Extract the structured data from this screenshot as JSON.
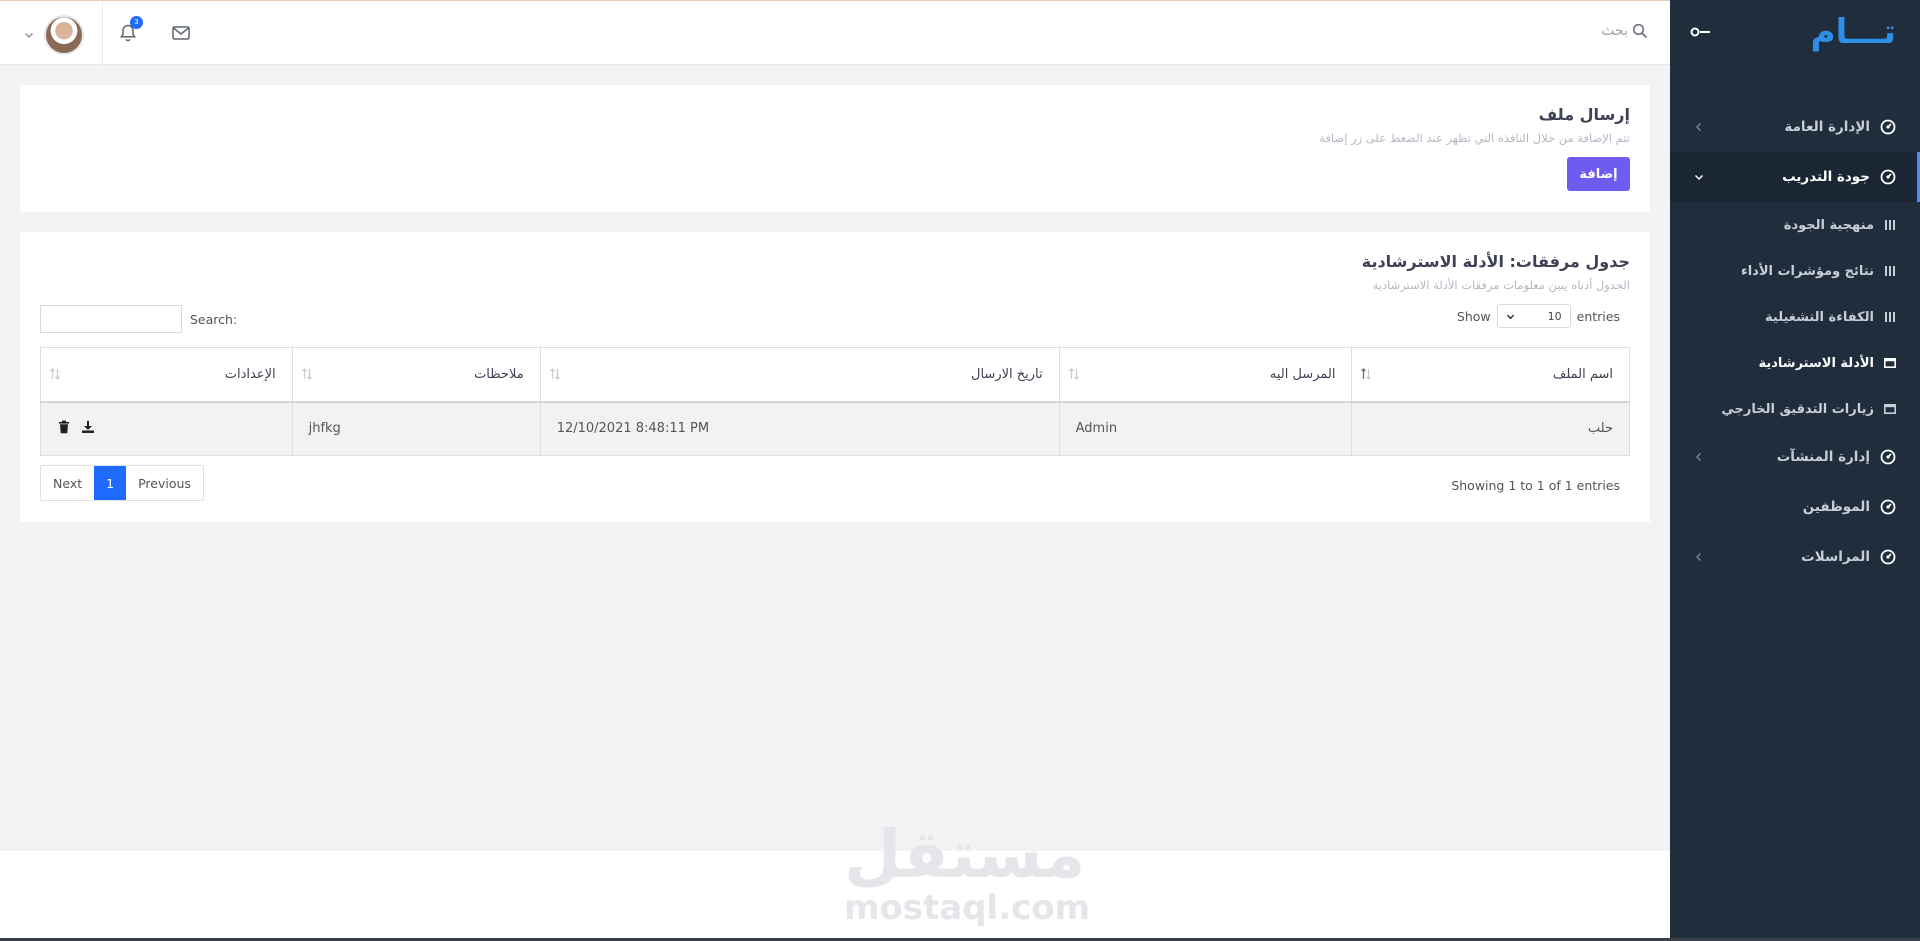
{
  "sidebar": {
    "logo_text": "تـــام",
    "items": [
      {
        "label": "الإدارة العامة",
        "icon": "gauge-icon",
        "has_submenu": true
      },
      {
        "label": "جودة التدريب",
        "icon": "gauge-icon",
        "has_submenu": true,
        "open": true
      },
      {
        "label": "إدارة المنشآت",
        "icon": "gauge-icon",
        "has_submenu": true
      },
      {
        "label": "الموظفين",
        "icon": "gauge-icon",
        "has_submenu": false
      },
      {
        "label": "المراسلات",
        "icon": "gauge-icon",
        "has_submenu": true
      }
    ],
    "subitems": [
      {
        "label": "منهجية الجودة",
        "icon": "bars-icon"
      },
      {
        "label": "نتائج ومؤشرات الأداء",
        "icon": "bars-icon"
      },
      {
        "label": "الكفاءة التشغيلية",
        "icon": "bars-icon"
      },
      {
        "label": "الأدلة الاسترشادية",
        "icon": "window-icon",
        "active": true
      },
      {
        "label": "زيارات التدقيق الخارجي",
        "icon": "window-icon"
      }
    ]
  },
  "topbar": {
    "search_placeholder": "بحث",
    "notification_count": "3"
  },
  "upload_card": {
    "title": "إرسال ملف",
    "subtitle": "تتم الإضافة من خلال النافذة التي تظهر عند الضغط على زر إضافة",
    "add_button": "إضافة"
  },
  "table_card": {
    "title": "جدول مرفقات: الأدلة الاسترشادية",
    "subtitle": "الجدول أدناه يبين معلومات مرفقات الأدلة الاسترشادية",
    "show_label": "Show",
    "entries_value": "10",
    "entries_label": "entries",
    "search_label": "Search:",
    "columns": [
      "اسم الملف",
      "المرسل اليه",
      "تاريخ الارسال",
      "ملاحظات",
      "الإعدادات"
    ],
    "rows": [
      {
        "file_name": "حلب",
        "recipient": "Admin",
        "date": "12/10/2021 8:48:11 PM",
        "notes": "jhfkg"
      }
    ],
    "info": "Showing 1 to 1 of 1 entries",
    "pagination": {
      "previous": "Previous",
      "current": "1",
      "next": "Next"
    }
  },
  "watermark": {
    "arabic": "مستقل",
    "latin": "mostaql.com"
  },
  "colors": {
    "sidebar_bg": "#1f2d3d",
    "accent_blue": "#1f6bff",
    "add_button": "#6f5bf0",
    "logo": "#2e8fe8"
  }
}
